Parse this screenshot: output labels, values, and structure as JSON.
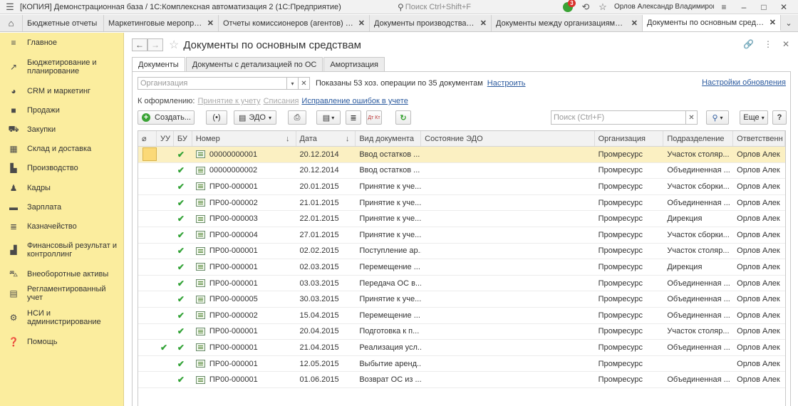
{
  "titlebar": {
    "title": "[КОПИЯ] Демонстрационная база / 1С:Комплексная автоматизация 2  (1С:Предприятие)",
    "search_placeholder": "Поиск Ctrl+Shift+F",
    "notifications_count": "3",
    "user": "Орлов Александр Владимирович"
  },
  "tabs": [
    {
      "label": "Бюджетные отчеты",
      "active": false
    },
    {
      "label": "Маркетинговые мероприятия",
      "active": false
    },
    {
      "label": "Отчеты комиссионеров (агентов) о пр...",
      "active": false
    },
    {
      "label": "Документы производства (все)",
      "active": false
    },
    {
      "label": "Документы между организациями (все)",
      "active": false
    },
    {
      "label": "Документы по основным средствам",
      "active": true
    }
  ],
  "sidebar": {
    "items": [
      {
        "label": "Главное",
        "icon": "hamburger-icon"
      },
      {
        "label": "Бюджетирование и планирование",
        "icon": "chart-icon"
      },
      {
        "label": "CRM и маркетинг",
        "icon": "pie-icon"
      },
      {
        "label": "Продажи",
        "icon": "bag-icon"
      },
      {
        "label": "Закупки",
        "icon": "cart-icon"
      },
      {
        "label": "Склад и доставка",
        "icon": "grid-icon"
      },
      {
        "label": "Производство",
        "icon": "factory-icon"
      },
      {
        "label": "Кадры",
        "icon": "person-icon"
      },
      {
        "label": "Зарплата",
        "icon": "money-icon"
      },
      {
        "label": "Казначейство",
        "icon": "coins-icon"
      },
      {
        "label": "Финансовый результат и контроллинг",
        "icon": "bars-icon"
      },
      {
        "label": "Внеоборотные активы",
        "icon": "car-icon"
      },
      {
        "label": "Регламентированный учет",
        "icon": "calculator-icon"
      },
      {
        "label": "НСИ и администрирование",
        "icon": "gear-icon"
      },
      {
        "label": "Помощь",
        "icon": "help-icon"
      }
    ]
  },
  "page": {
    "title": "Документы по основным средствам",
    "form_tabs": [
      {
        "label": "Документы",
        "active": true
      },
      {
        "label": "Документы с детализацией по ОС",
        "active": false
      },
      {
        "label": "Амортизация",
        "active": false
      }
    ]
  },
  "filter": {
    "org_placeholder": "Организация",
    "shown_text": "Показаны 53 хоз. операции по 35 документам",
    "configure_link": "Настроить",
    "refresh_settings_link": "Настройки обновления"
  },
  "processing": {
    "label": "К оформлению:",
    "link1": "Принятие к учету",
    "link2": "Списания",
    "link3": "Исправление ошибок в учете"
  },
  "toolbar": {
    "create_label": "Создать...",
    "edo_label": "ЭДО",
    "search_placeholder": "Поиск (Ctrl+F)",
    "more_label": "Еще",
    "help_label": "?",
    "dt_kt_label": "Дт Кт"
  },
  "table": {
    "columns": [
      "",
      "УУ",
      "БУ",
      "Номер",
      "Дата",
      "Вид документа",
      "Состояние ЭДО",
      "Организация",
      "Подразделение",
      "Ответственн"
    ],
    "rows": [
      {
        "uu": false,
        "bu": true,
        "number": "00000000001",
        "date": "20.12.2014",
        "kind": "Ввод остатков ...",
        "edo": "",
        "org": "Промресурс",
        "dept": "Участок столяр...",
        "resp": "Орлов Алек",
        "selected": true
      },
      {
        "uu": false,
        "bu": true,
        "number": "00000000002",
        "date": "20.12.2014",
        "kind": "Ввод остатков ...",
        "edo": "",
        "org": "Промресурс",
        "dept": "Объединенная ...",
        "resp": "Орлов Алек",
        "selected": false
      },
      {
        "uu": false,
        "bu": true,
        "number": "ПР00-000001",
        "date": "20.01.2015",
        "kind": "Принятие к уче...",
        "edo": "",
        "org": "Промресурс",
        "dept": "Участок сборки...",
        "resp": "Орлов Алек",
        "selected": false
      },
      {
        "uu": false,
        "bu": true,
        "number": "ПР00-000002",
        "date": "21.01.2015",
        "kind": "Принятие к уче...",
        "edo": "",
        "org": "Промресурс",
        "dept": "Объединенная ...",
        "resp": "Орлов Алек",
        "selected": false
      },
      {
        "uu": false,
        "bu": true,
        "number": "ПР00-000003",
        "date": "22.01.2015",
        "kind": "Принятие к уче...",
        "edo": "",
        "org": "Промресурс",
        "dept": "Дирекция",
        "resp": "Орлов Алек",
        "selected": false
      },
      {
        "uu": false,
        "bu": true,
        "number": "ПР00-000004",
        "date": "27.01.2015",
        "kind": "Принятие к уче...",
        "edo": "",
        "org": "Промресурс",
        "dept": "Участок сборки...",
        "resp": "Орлов Алек",
        "selected": false
      },
      {
        "uu": false,
        "bu": true,
        "number": "ПР00-000001",
        "date": "02.02.2015",
        "kind": "Поступление ар...",
        "edo": "",
        "org": "Промресурс",
        "dept": "Участок столяр...",
        "resp": "Орлов Алек",
        "selected": false
      },
      {
        "uu": false,
        "bu": true,
        "number": "ПР00-000001",
        "date": "02.03.2015",
        "kind": "Перемещение ...",
        "edo": "",
        "org": "Промресурс",
        "dept": "Дирекция",
        "resp": "Орлов Алек",
        "selected": false
      },
      {
        "uu": false,
        "bu": true,
        "number": "ПР00-000001",
        "date": "03.03.2015",
        "kind": "Передача ОС в...",
        "edo": "",
        "org": "Промресурс",
        "dept": "Объединенная ...",
        "resp": "Орлов Алек",
        "selected": false
      },
      {
        "uu": false,
        "bu": true,
        "number": "ПР00-000005",
        "date": "30.03.2015",
        "kind": "Принятие к уче...",
        "edo": "",
        "org": "Промресурс",
        "dept": "Объединенная ...",
        "resp": "Орлов Алек",
        "selected": false
      },
      {
        "uu": false,
        "bu": true,
        "number": "ПР00-000002",
        "date": "15.04.2015",
        "kind": "Перемещение ...",
        "edo": "",
        "org": "Промресурс",
        "dept": "Объединенная ...",
        "resp": "Орлов Алек",
        "selected": false
      },
      {
        "uu": false,
        "bu": true,
        "number": "ПР00-000001",
        "date": "20.04.2015",
        "kind": "Подготовка к п...",
        "edo": "",
        "org": "Промресурс",
        "dept": "Участок столяр...",
        "resp": "Орлов Алек",
        "selected": false
      },
      {
        "uu": true,
        "bu": true,
        "number": "ПР00-000001",
        "date": "21.04.2015",
        "kind": "Реализация усл...",
        "edo": "",
        "org": "Промресурс",
        "dept": "Объединенная ...",
        "resp": "Орлов Алек",
        "selected": false
      },
      {
        "uu": false,
        "bu": true,
        "number": "ПР00-000001",
        "date": "12.05.2015",
        "kind": "Выбытие аренд...",
        "edo": "",
        "org": "Промресурс",
        "dept": "",
        "resp": "Орлов Алек",
        "selected": false
      },
      {
        "uu": false,
        "bu": true,
        "number": "ПР00-000001",
        "date": "01.06.2015",
        "kind": "Возврат ОС из ...",
        "edo": "",
        "org": "Промресурс",
        "dept": "Объединенная ...",
        "resp": "Орлов Алек",
        "selected": false
      }
    ]
  },
  "colors": {
    "sidebar_bg": "#fbed9e",
    "selected_row": "#fbf0c2",
    "check_green": "#31a235",
    "link_blue": "#2b5a9e"
  }
}
